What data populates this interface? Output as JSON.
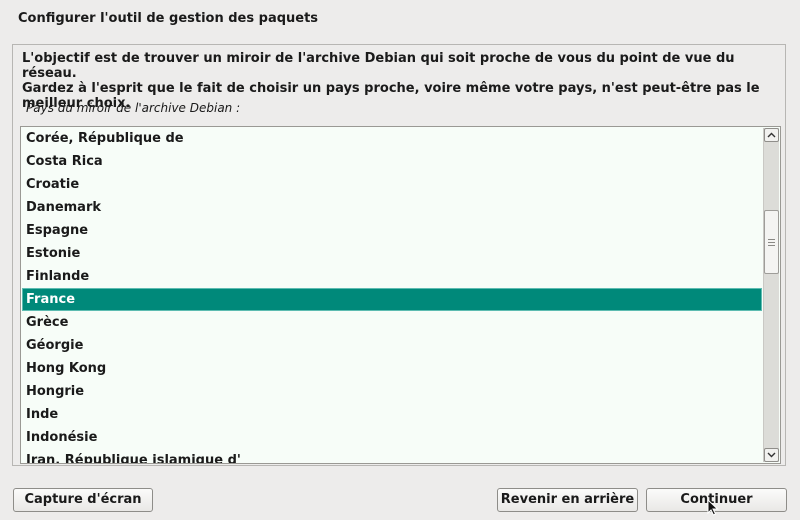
{
  "window": {
    "title": "Configurer l'outil de gestion des paquets"
  },
  "description": {
    "line1": "L'objectif est de trouver un miroir de l'archive Debian qui soit proche de vous du point de vue du réseau.",
    "line2": "Gardez à l'esprit que le fait de choisir un pays proche, voire même votre pays, n'est peut-être pas le meilleur choix."
  },
  "list": {
    "label": "Pays du miroir de l'archive Debian :",
    "items": [
      "Corée, République de",
      "Costa Rica",
      "Croatie",
      "Danemark",
      "Espagne",
      "Estonie",
      "Finlande",
      "France",
      "Grèce",
      "Géorgie",
      "Hong Kong",
      "Hongrie",
      "Inde",
      "Indonésie",
      "Iran, République islamique d'"
    ],
    "selected": "France"
  },
  "buttons": {
    "screenshot": "Capture d'écran",
    "back": "Revenir en arrière",
    "continue": "Continuer"
  },
  "icons": {
    "scroll_up": "chevron-up-icon",
    "scroll_down": "chevron-down-icon",
    "cursor": "mouse-pointer-icon"
  },
  "colors": {
    "background": "#edeceb",
    "list_background": "#f7fdf8",
    "selection": "#00897a"
  }
}
